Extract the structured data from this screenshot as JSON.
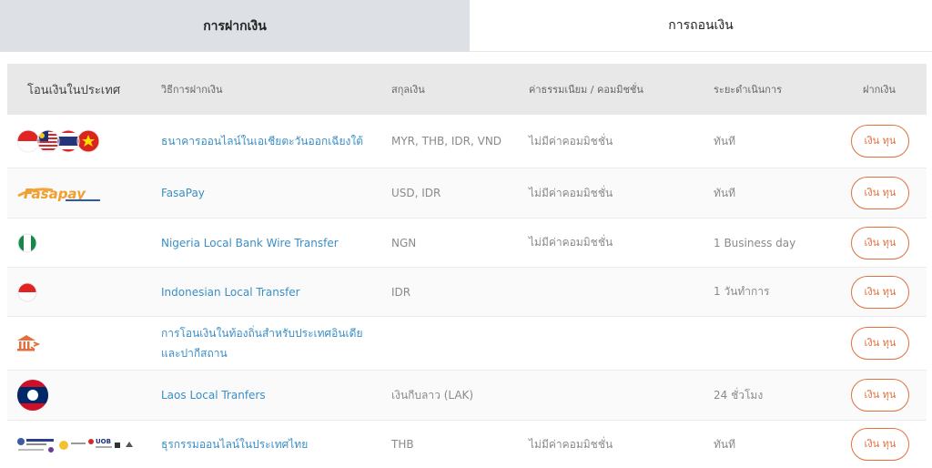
{
  "tabs": {
    "deposit": "การฝากเงิน",
    "withdraw": "การถอนเงิน"
  },
  "table": {
    "headers": {
      "transfer_type": "โอนเงินในประเทศ",
      "method": "วิธีการฝากเงิน",
      "currency": "สกุลเงิน",
      "fees": "ค่าธรรมเนียม / คอมมิชชั่น",
      "processing": "ระยะดำเนินการ",
      "deposit": "ฝากเงิน"
    },
    "button_label": "เงิน ทุน",
    "rows": [
      {
        "method": "ธนาคารออนไลน์ในเอเชียตะวันออกเฉียงใต้",
        "currency": "MYR, THB, IDR, VND",
        "fees": "ไม่มีค่าคอมมิชชั่น",
        "processing": "ทันที"
      },
      {
        "method": "FasaPay",
        "currency": "USD, IDR",
        "fees": "ไม่มีค่าคอมมิชชั่น",
        "processing": "ทันที"
      },
      {
        "method": "Nigeria Local Bank Wire Transfer",
        "currency": "NGN",
        "fees": "ไม่มีค่าคอมมิชชั่น",
        "processing": "1 Business day"
      },
      {
        "method": "Indonesian Local Transfer",
        "currency": "IDR",
        "fees": "",
        "processing": "1 วันทำการ"
      },
      {
        "method": "การโอนเงินในท้องถิ่นสำหรับประเทศอินเดียและปากีสถาน",
        "currency": "",
        "fees": "",
        "processing": ""
      },
      {
        "method": "Laos Local Tranfers",
        "currency": "เงินกีบลาว (LAK)",
        "fees": "",
        "processing": "24 ชั่วโมง"
      },
      {
        "method": "ธุรกรรมออนไลน์ในประเทศไทย",
        "currency": "THB",
        "fees": "ไม่มีค่าคอมมิชชั่น",
        "processing": "ทันที"
      }
    ]
  },
  "logos": {
    "fasapay_text": "Fasapay",
    "thai_bank_text": "UOB"
  },
  "colors": {
    "accent": "#e0703f",
    "link": "#3a8fc6",
    "header_bg": "#e8e8e8",
    "active_tab_bg": "#dde1e6"
  }
}
